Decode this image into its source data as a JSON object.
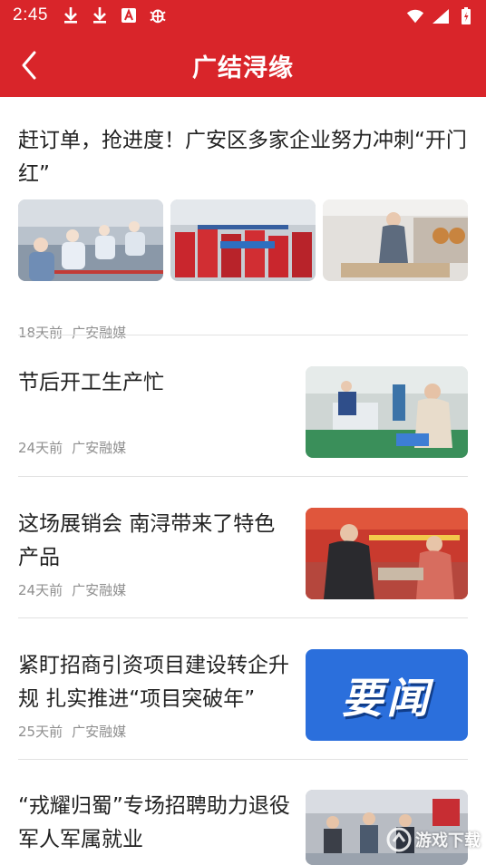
{
  "status_bar": {
    "time": "2:45",
    "icons_left": [
      "download-icon",
      "download-icon",
      "app-a-icon",
      "bug-icon"
    ],
    "icons_right": [
      "wifi-icon",
      "signal-icon",
      "battery-icon"
    ]
  },
  "header": {
    "title": "广结浔缘",
    "back_icon": "chevron-left-icon"
  },
  "feed": {
    "items": [
      {
        "title": "赶订单，抢进度！广安区多家企业努力冲刺“开门红”",
        "time": "18天前",
        "source": "广安融媒",
        "layout": "three-images"
      },
      {
        "title": "节后开工生产忙",
        "time": "24天前",
        "source": "广安融媒",
        "layout": "right-image"
      },
      {
        "title": "这场展销会 南浔带来了特色产品",
        "time": "24天前",
        "source": "广安融媒",
        "layout": "right-image"
      },
      {
        "title": "紧盯招商引资项目建设转企升规 扎实推进“项目突破年”",
        "time": "25天前",
        "source": "广安融媒",
        "layout": "right-image",
        "image_label": "要闻"
      },
      {
        "title": "“戎耀归蜀”专场招聘助力退役军人军属就业",
        "time": "",
        "source": "",
        "layout": "right-image"
      }
    ]
  },
  "watermark": {
    "text": "游戏下载"
  },
  "colors": {
    "brand_red": "#d9252a",
    "meta_gray": "#8f8f8f",
    "divider": "#e2e2e2",
    "yaowen_blue": "#2b6fdc"
  }
}
